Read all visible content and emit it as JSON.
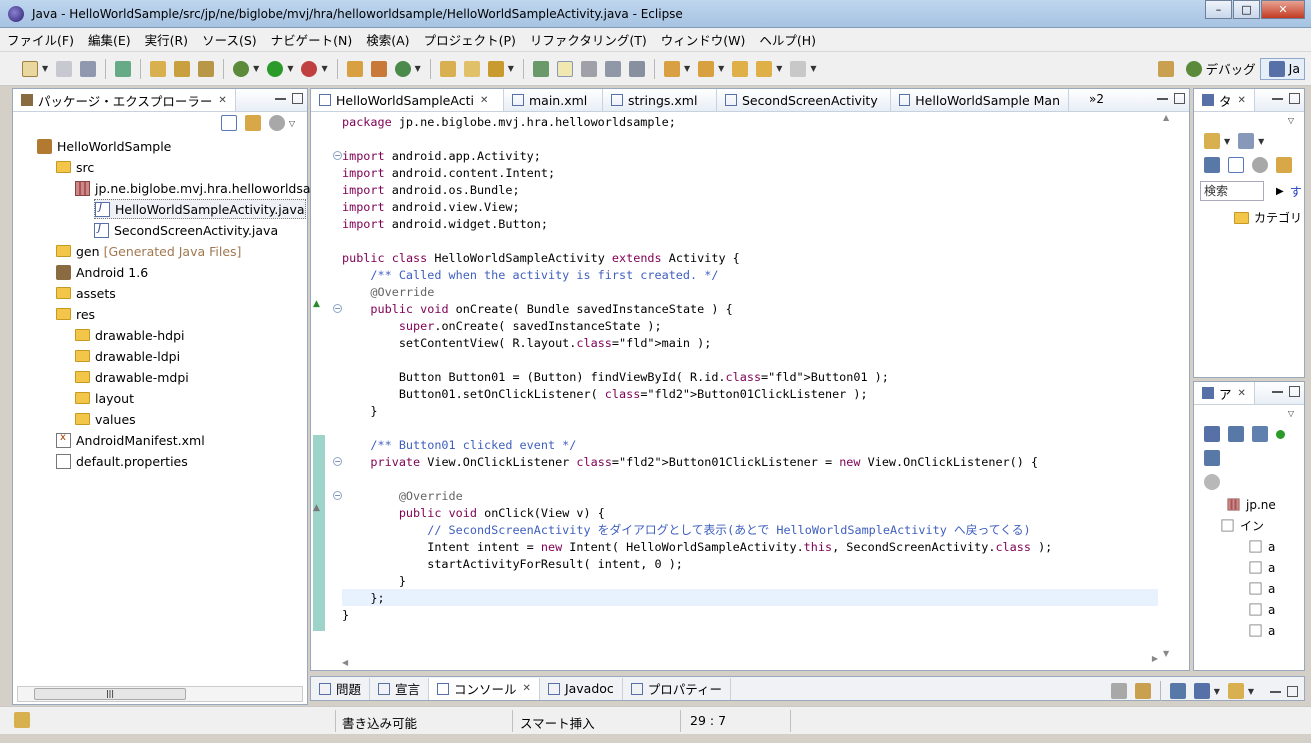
{
  "window": {
    "title": "Java - HelloWorldSample/src/jp/ne/biglobe/mvj/hra/helloworldsample/HelloWorldSampleActivity.java - Eclipse"
  },
  "menu": [
    "ファイル(F)",
    "編集(E)",
    "実行(R)",
    "ソース(S)",
    "ナビゲート(N)",
    "検索(A)",
    "プロジェクト(P)",
    "リファクタリング(T)",
    "ウィンドウ(W)",
    "ヘルプ(H)"
  ],
  "perspectives": {
    "debug": "デバッグ",
    "java": "Ja"
  },
  "explorer": {
    "title": "パッケージ・エクスプローラー",
    "items": [
      {
        "label": "HelloWorldSample",
        "icon": "project",
        "indent": 0
      },
      {
        "label": "src",
        "icon": "folder",
        "indent": 1
      },
      {
        "label": "jp.ne.biglobe.mvj.hra.helloworldsan",
        "icon": "package",
        "indent": 2
      },
      {
        "label": "HelloWorldSampleActivity.java",
        "icon": "java",
        "indent": 3,
        "selected": true
      },
      {
        "label": "SecondScreenActivity.java",
        "icon": "java",
        "indent": 3
      },
      {
        "label": "gen",
        "icon": "folder",
        "indent": 1,
        "suffix": "[Generated Java Files]"
      },
      {
        "label": "Android 1.6",
        "icon": "library",
        "indent": 1
      },
      {
        "label": "assets",
        "icon": "folder",
        "indent": 1
      },
      {
        "label": "res",
        "icon": "folder",
        "indent": 1
      },
      {
        "label": "drawable-hdpi",
        "icon": "folder",
        "indent": 2
      },
      {
        "label": "drawable-ldpi",
        "icon": "folder",
        "indent": 2
      },
      {
        "label": "drawable-mdpi",
        "icon": "folder",
        "indent": 2
      },
      {
        "label": "layout",
        "icon": "folder",
        "indent": 2
      },
      {
        "label": "values",
        "icon": "folder",
        "indent": 2
      },
      {
        "label": "AndroidManifest.xml",
        "icon": "xml",
        "indent": 1
      },
      {
        "label": "default.properties",
        "icon": "file",
        "indent": 1
      }
    ]
  },
  "editor_tabs": [
    {
      "label": "HelloWorldSampleActi",
      "active": true
    },
    {
      "label": "main.xml"
    },
    {
      "label": "strings.xml"
    },
    {
      "label": "SecondScreenActivity"
    },
    {
      "label": "HelloWorldSample Man"
    }
  ],
  "editor_overflow": "»2",
  "code": [
    "package jp.ne.biglobe.mvj.hra.helloworldsample;",
    "",
    "import android.app.Activity;",
    "import android.content.Intent;",
    "import android.os.Bundle;",
    "import android.view.View;",
    "import android.widget.Button;",
    "",
    "public class HelloWorldSampleActivity extends Activity {",
    "    /** Called when the activity is first created. */",
    "    @Override",
    "    public void onCreate( Bundle savedInstanceState ) {",
    "        super.onCreate( savedInstanceState );",
    "        setContentView( R.layout.main );",
    "",
    "        Button Button01 = (Button) findViewById( R.id.Button01 );",
    "        Button01.setOnClickListener( Button01ClickListener );",
    "    }",
    "",
    "    /** Button01 clicked event */",
    "    private View.OnClickListener Button01ClickListener = new View.OnClickListener() {",
    "",
    "        @Override",
    "        public void onClick(View v) {",
    "            // SecondScreenActivity をダイアログとして表示(あとで HelloWorldSampleActivity へ戻ってくる)",
    "            Intent intent = new Intent( HelloWorldSampleActivity.this, SecondScreenActivity.class );",
    "            startActivityForResult( intent, 0 );",
    "        }",
    "    };",
    "}"
  ],
  "right_top": {
    "tab": "タ",
    "search_placeholder": "検索",
    "category": "カテゴリ",
    "link": "す"
  },
  "right_bottom": {
    "tab": "ア",
    "items": [
      "jp.ne",
      "イン",
      "a",
      "a",
      "a",
      "a",
      "a"
    ]
  },
  "bottom_tabs": [
    "問題",
    "宣言",
    "コンソール",
    "Javadoc",
    "プロパティー"
  ],
  "status": {
    "writable": "書き込み可能",
    "insert": "スマート挿入",
    "position": "29 : 7"
  }
}
